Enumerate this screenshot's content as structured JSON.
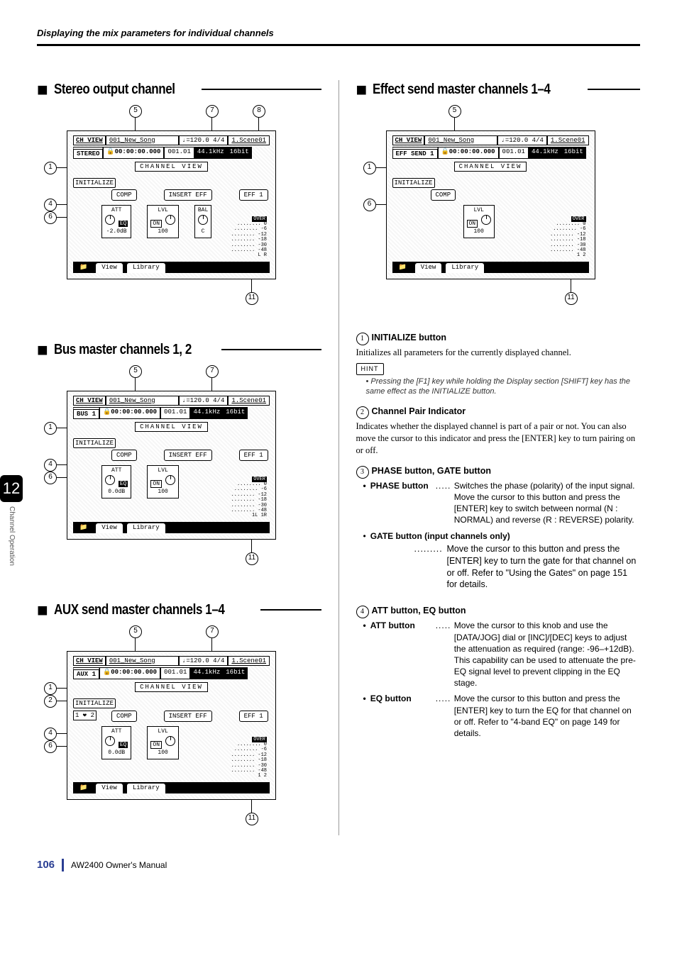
{
  "page_header": "Displaying the mix parameters for individual channels",
  "chapter": {
    "number": "12",
    "name": "Channel Operation"
  },
  "left_column": {
    "sections": [
      {
        "title": "Stereo output channel",
        "screenshot": {
          "ch_view": "CH VIEW",
          "song": "001_New_Song",
          "tempo": "♩=120.0  4/4",
          "scene": "1.Scene01",
          "channel": "STEREO",
          "time": "🔒00:00:00.000",
          "bar": "001.01",
          "rate": "44.1kHz",
          "bits": "16bit",
          "body_label": "CHANNEL VIEW",
          "init": "INITIALIZE",
          "mid1": "COMP",
          "mid2": "INSERT EFF",
          "mid3": "EFF 1",
          "att_label": "ATT",
          "eq_label": "EQ",
          "att_value": "-2.0dB",
          "on_label": "ON",
          "lvl_label": "LVL",
          "lvl_value": "100",
          "bal_label": "BAL",
          "bal_value": "C",
          "meter_over": "OVER",
          "meter_scale": [
            "0",
            "-6",
            "-12",
            "-18",
            "-30",
            "-48"
          ],
          "meter_lr": "L  R",
          "tab1": "📁",
          "tab2": "View",
          "tab3": "Library"
        },
        "callouts_top": [
          "5",
          "7",
          "8"
        ],
        "callouts_left": [
          "1",
          "4",
          "6"
        ],
        "callout_bottom": "11"
      },
      {
        "title": "Bus master channels 1, 2",
        "screenshot": {
          "ch_view": "CH VIEW",
          "song": "001_New_Song",
          "tempo": "♩=120.0  4/4",
          "scene": "1.Scene01",
          "channel": "BUS 1",
          "time": "🔒00:00:00.000",
          "bar": "001.01",
          "rate": "44.1kHz",
          "bits": "16bit",
          "body_label": "CHANNEL VIEW",
          "init": "INITIALIZE",
          "mid1": "COMP",
          "mid2": "INSERT EFF",
          "mid3": "EFF 1",
          "att_label": "ATT",
          "eq_label": "EQ",
          "att_value": "0.0dB",
          "on_label": "ON",
          "lvl_label": "LVL",
          "lvl_value": "100",
          "bal_label": "",
          "bal_value": "",
          "meter_over": "OVER",
          "meter_scale": [
            "0",
            "-6",
            "-12",
            "-18",
            "-30",
            "-48"
          ],
          "meter_lr": "1L 1R",
          "tab1": "📁",
          "tab2": "View",
          "tab3": "Library"
        },
        "callouts_top": [
          "5",
          "7"
        ],
        "callouts_left": [
          "1",
          "4",
          "6"
        ],
        "callout_bottom": "11"
      },
      {
        "title": "AUX send master channels 1–4",
        "screenshot": {
          "ch_view": "CH VIEW",
          "song": "001_New_Song",
          "tempo": "♩=120.0  4/4",
          "scene": "1.Scene01",
          "channel": "AUX 1",
          "time": "🔒00:00:00.000",
          "bar": "001.01",
          "rate": "44.1kHz",
          "bits": "16bit",
          "body_label": "CHANNEL VIEW",
          "init": "INITIALIZE",
          "mid1": "COMP",
          "mid2": "INSERT EFF",
          "mid3": "EFF 1",
          "pair": "1 ❤ 2",
          "att_label": "ATT",
          "eq_label": "EQ",
          "att_value": "0.0dB",
          "on_label": "ON",
          "lvl_label": "LVL",
          "lvl_value": "100",
          "bal_label": "",
          "bal_value": "",
          "meter_over": "OVER",
          "meter_scale": [
            "0",
            "-6",
            "-12",
            "-18",
            "-30",
            "-48"
          ],
          "meter_lr": "1  2",
          "tab1": "📁",
          "tab2": "View",
          "tab3": "Library"
        },
        "callouts_top": [
          "5",
          "7"
        ],
        "callouts_left": [
          "1",
          "2",
          "4",
          "6"
        ],
        "callout_bottom": "11"
      }
    ]
  },
  "right_column": {
    "section": {
      "title": "Effect send master channels 1–4",
      "screenshot": {
        "ch_view": "CH VIEW",
        "song": "001_New_Song",
        "tempo": "♩=120.0  4/4",
        "scene": "1.Scene01",
        "channel": "EFF SEND 1",
        "time": "🔒00:00:00.000",
        "bar": "001.01",
        "rate": "44.1kHz",
        "bits": "16bit",
        "body_label": "CHANNEL VIEW",
        "init": "INITIALIZE",
        "mid1": "COMP",
        "on_label": "ON",
        "lvl_label": "LVL",
        "lvl_value": "100",
        "meter_over": "OVER",
        "meter_scale": [
          "0",
          "-6",
          "-12",
          "-18",
          "-30",
          "-48"
        ],
        "meter_lr": "1  2",
        "tab1": "📁",
        "tab2": "View",
        "tab3": "Library"
      },
      "callouts_top": [
        "5"
      ],
      "callouts_left": [
        "1",
        "6"
      ],
      "callout_bottom": "11"
    },
    "descriptions": {
      "item1": {
        "num": "1",
        "heading": "INITIALIZE button",
        "text": "Initializes all parameters for the currently displayed channel."
      },
      "hint": {
        "label": "HINT",
        "text": "Pressing the [F1] key while holding the Display section [SHIFT] key has the same effect as the INITIALIZE button."
      },
      "item2": {
        "num": "2",
        "heading": "Channel Pair Indicator",
        "text": "Indicates whether the displayed channel is part of a pair or not. You can also move the cursor to this indicator and press the [ENTER] key to turn pairing on or off."
      },
      "item3": {
        "num": "3",
        "heading": "PHASE button, GATE button",
        "phase_label": "PHASE button",
        "phase_desc": "Switches the phase (polarity) of the input signal. Move the cursor to this button and press the [ENTER] key to switch between normal (N : NORMAL) and reverse (R : REVERSE) polarity.",
        "gate_label": "GATE button (input channels only)",
        "gate_desc": "Move the cursor to this button and press the [ENTER] key to turn the gate for that channel on or off. Refer to \"Using the Gates\" on page 151 for details."
      },
      "item4": {
        "num": "4",
        "heading": "ATT button, EQ button",
        "att_label": "ATT button",
        "att_desc": "Move the cursor to this knob and use the [DATA/JOG] dial or [INC]/[DEC] keys to adjust the attenuation as required (range: -96–+12dB). This capability can be used to attenuate the pre-EQ signal level to prevent clipping in the EQ stage.",
        "eq_label": "EQ button",
        "eq_desc": "Move the cursor to this button and press the [ENTER] key to turn the EQ for that channel on or off. Refer to \"4-band EQ\" on page 149 for details."
      }
    }
  },
  "footer": {
    "page": "106",
    "manual": "AW2400  Owner's Manual"
  }
}
